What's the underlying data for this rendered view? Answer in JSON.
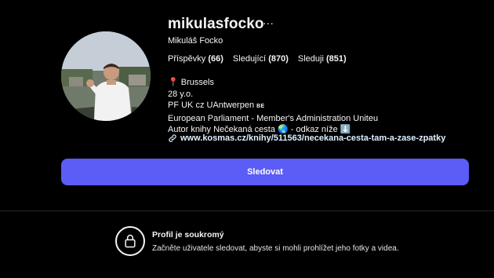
{
  "profile": {
    "username": "mikulasfocko",
    "full_name": "Mikuláš Focko",
    "more_label": "···"
  },
  "stats": {
    "posts_label": "Příspěvky",
    "posts_count": "(66)",
    "followers_label": "Sledující",
    "followers_count": "(870)",
    "following_label": "Sleduji",
    "following_count": "(851)"
  },
  "bio": {
    "location_emoji": "📍",
    "location": "Brussels",
    "age": "28 y.o.",
    "school_prefix": "PF UK",
    "school_cz_flag": "cz",
    "school_second": "UAntwerpen",
    "school_be_flag": "BE",
    "work": "European Parliament - Member's Administration Unit",
    "work_flag": "eu",
    "book_line": "Autor knihy Nečekaná cesta",
    "globe_emoji": "🌏",
    "book_suffix": "- odkaz níže",
    "arrow_emoji": "⬇️"
  },
  "link": {
    "icon": "link-icon",
    "url": "www.kosmas.cz/knihy/511563/necekana-cesta-tam-a-zase-zpatky"
  },
  "actions": {
    "follow_label": "Sledovat"
  },
  "private_notice": {
    "icon": "lock-icon",
    "title": "Profil je soukromý",
    "text": "Začněte uživatele sledovat, abyste si mohli prohlížet jeho fotky a videa."
  },
  "colors": {
    "background": "#000000",
    "accent": "#5c5cf6",
    "link": "#e0f1ff",
    "divider": "#262626"
  }
}
